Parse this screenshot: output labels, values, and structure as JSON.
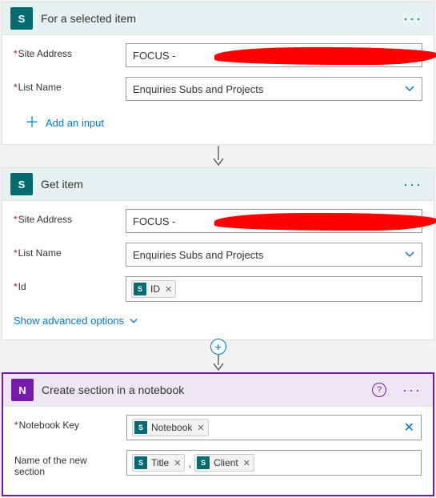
{
  "cards": [
    {
      "icon_letter": "S",
      "title": "For a selected item",
      "fields": {
        "site_label": "Site Address",
        "site_value": "FOCUS - ",
        "list_label": "List Name",
        "list_value": "Enquiries Subs and Projects"
      },
      "add_input": "Add an input"
    },
    {
      "icon_letter": "S",
      "title": "Get item",
      "fields": {
        "site_label": "Site Address",
        "site_value": "FOCUS - ",
        "list_label": "List Name",
        "list_value": "Enquiries Subs and Projects",
        "id_label": "Id",
        "id_token": "ID"
      },
      "advanced": "Show advanced options"
    },
    {
      "icon_letter": "N",
      "title": "Create section in a notebook",
      "fields": {
        "key_label": "Notebook Key",
        "key_token": "Notebook",
        "section_label": "Name of the new section",
        "section_token1": "Title",
        "section_token2": "Client"
      }
    }
  ]
}
